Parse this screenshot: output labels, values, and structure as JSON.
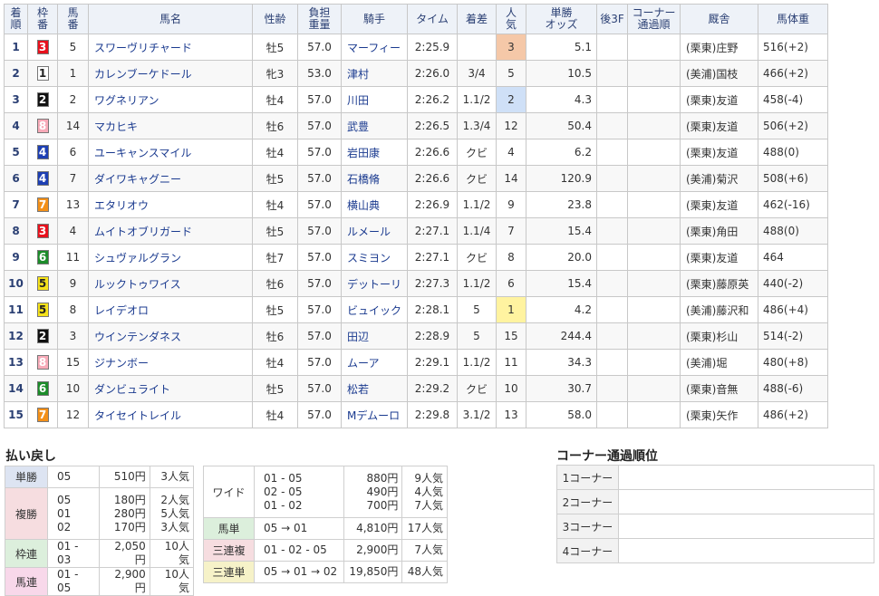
{
  "headers": {
    "chaku": [
      "着",
      "順"
    ],
    "waku": [
      "枠",
      "番"
    ],
    "uma": [
      "馬",
      "番"
    ],
    "name": "馬名",
    "sexage": "性齢",
    "futan": [
      "負担",
      "重量"
    ],
    "jockey": "騎手",
    "time": "タイム",
    "margin": "着差",
    "ninki": [
      "人",
      "気"
    ],
    "odds": [
      "単勝",
      "オッズ"
    ],
    "last3f": "後3F",
    "corner": [
      "コーナー",
      "通過順"
    ],
    "stable": "厩舎",
    "weight": "馬体重"
  },
  "waku_colors": {
    "1": "#ffffff",
    "2": "#111111",
    "3": "#e8111d",
    "4": "#1d3fb3",
    "5": "#f5e21a",
    "6": "#1c8c2a",
    "7": "#f39019",
    "8": "#f7aab8"
  },
  "rows": [
    {
      "chaku": "1",
      "waku": "3",
      "uma": "5",
      "name": "スワーヴリチャード",
      "sexage": "牡5",
      "futan": "57.0",
      "jockey": "マーフィー",
      "time": "2:25.9",
      "margin": "",
      "ninki": "3",
      "odds": "5.1",
      "last3f": "",
      "corner": "",
      "stable": "(栗東)庄野",
      "weight": "516(+2)"
    },
    {
      "chaku": "2",
      "waku": "1",
      "uma": "1",
      "name": "カレンブーケドール",
      "sexage": "牝3",
      "futan": "53.0",
      "jockey": "津村",
      "time": "2:26.0",
      "margin": "3/4",
      "ninki": "5",
      "odds": "10.5",
      "last3f": "",
      "corner": "",
      "stable": "(美浦)国枝",
      "weight": "466(+2)"
    },
    {
      "chaku": "3",
      "waku": "2",
      "uma": "2",
      "name": "ワグネリアン",
      "sexage": "牡4",
      "futan": "57.0",
      "jockey": "川田",
      "time": "2:26.2",
      "margin": "1.1/2",
      "ninki": "2",
      "odds": "4.3",
      "last3f": "",
      "corner": "",
      "stable": "(栗東)友道",
      "weight": "458(-4)"
    },
    {
      "chaku": "4",
      "waku": "8",
      "uma": "14",
      "name": "マカヒキ",
      "sexage": "牡6",
      "futan": "57.0",
      "jockey": "武豊",
      "time": "2:26.5",
      "margin": "1.3/4",
      "ninki": "12",
      "odds": "50.4",
      "last3f": "",
      "corner": "",
      "stable": "(栗東)友道",
      "weight": "506(+2)"
    },
    {
      "chaku": "5",
      "waku": "4",
      "uma": "6",
      "name": "ユーキャンスマイル",
      "sexage": "牡4",
      "futan": "57.0",
      "jockey": "岩田康",
      "time": "2:26.6",
      "margin": "クビ",
      "ninki": "4",
      "odds": "6.2",
      "last3f": "",
      "corner": "",
      "stable": "(栗東)友道",
      "weight": "488(0)"
    },
    {
      "chaku": "6",
      "waku": "4",
      "uma": "7",
      "name": "ダイワキャグニー",
      "sexage": "牡5",
      "futan": "57.0",
      "jockey": "石橋脩",
      "time": "2:26.6",
      "margin": "クビ",
      "ninki": "14",
      "odds": "120.9",
      "last3f": "",
      "corner": "",
      "stable": "(美浦)菊沢",
      "weight": "508(+6)"
    },
    {
      "chaku": "7",
      "waku": "7",
      "uma": "13",
      "name": "エタリオウ",
      "sexage": "牡4",
      "futan": "57.0",
      "jockey": "横山典",
      "time": "2:26.9",
      "margin": "1.1/2",
      "ninki": "9",
      "odds": "23.8",
      "last3f": "",
      "corner": "",
      "stable": "(栗東)友道",
      "weight": "462(-16)"
    },
    {
      "chaku": "8",
      "waku": "3",
      "uma": "4",
      "name": "ムイトオブリガード",
      "sexage": "牡5",
      "futan": "57.0",
      "jockey": "ルメール",
      "time": "2:27.1",
      "margin": "1.1/4",
      "ninki": "7",
      "odds": "15.4",
      "last3f": "",
      "corner": "",
      "stable": "(栗東)角田",
      "weight": "488(0)"
    },
    {
      "chaku": "9",
      "waku": "6",
      "uma": "11",
      "name": "シュヴァルグラン",
      "sexage": "牡7",
      "futan": "57.0",
      "jockey": "スミヨン",
      "time": "2:27.1",
      "margin": "クビ",
      "ninki": "8",
      "odds": "20.0",
      "last3f": "",
      "corner": "",
      "stable": "(栗東)友道",
      "weight": "464"
    },
    {
      "chaku": "10",
      "waku": "5",
      "uma": "9",
      "name": "ルックトゥワイス",
      "sexage": "牡6",
      "futan": "57.0",
      "jockey": "デットーリ",
      "time": "2:27.3",
      "margin": "1.1/2",
      "ninki": "6",
      "odds": "15.4",
      "last3f": "",
      "corner": "",
      "stable": "(栗東)藤原英",
      "weight": "440(-2)"
    },
    {
      "chaku": "11",
      "waku": "5",
      "uma": "8",
      "name": "レイデオロ",
      "sexage": "牡5",
      "futan": "57.0",
      "jockey": "ビュイック",
      "time": "2:28.1",
      "margin": "5",
      "ninki": "1",
      "odds": "4.2",
      "last3f": "",
      "corner": "",
      "stable": "(美浦)藤沢和",
      "weight": "486(+4)"
    },
    {
      "chaku": "12",
      "waku": "2",
      "uma": "3",
      "name": "ウインテンダネス",
      "sexage": "牡6",
      "futan": "57.0",
      "jockey": "田辺",
      "time": "2:28.9",
      "margin": "5",
      "ninki": "15",
      "odds": "244.4",
      "last3f": "",
      "corner": "",
      "stable": "(栗東)杉山",
      "weight": "514(-2)"
    },
    {
      "chaku": "13",
      "waku": "8",
      "uma": "15",
      "name": "ジナンボー",
      "sexage": "牡4",
      "futan": "57.0",
      "jockey": "ムーア",
      "time": "2:29.1",
      "margin": "1.1/2",
      "ninki": "11",
      "odds": "34.3",
      "last3f": "",
      "corner": "",
      "stable": "(美浦)堀",
      "weight": "480(+8)"
    },
    {
      "chaku": "14",
      "waku": "6",
      "uma": "10",
      "name": "ダンビュライト",
      "sexage": "牡5",
      "futan": "57.0",
      "jockey": "松若",
      "time": "2:29.2",
      "margin": "クビ",
      "ninki": "10",
      "odds": "30.7",
      "last3f": "",
      "corner": "",
      "stable": "(栗東)音無",
      "weight": "488(-6)"
    },
    {
      "chaku": "15",
      "waku": "7",
      "uma": "12",
      "name": "タイセイトレイル",
      "sexage": "牡4",
      "futan": "57.0",
      "jockey": "Mデムーロ",
      "time": "2:29.8",
      "margin": "3.1/2",
      "ninki": "13",
      "odds": "58.0",
      "last3f": "",
      "corner": "",
      "stable": "(栗東)矢作",
      "weight": "486(+2)"
    }
  ],
  "payout": {
    "title": "払い戻し",
    "tansho": {
      "label": "単勝",
      "combo": "05",
      "amount": "510円",
      "pop": "3人気"
    },
    "fukusho": {
      "label": "複勝",
      "lines": [
        {
          "combo": "05",
          "amount": "180円",
          "pop": "2人気"
        },
        {
          "combo": "01",
          "amount": "280円",
          "pop": "5人気"
        },
        {
          "combo": "02",
          "amount": "170円",
          "pop": "3人気"
        }
      ]
    },
    "wakuren": {
      "label": "枠連",
      "combo": "01 - 03",
      "amount": "2,050円",
      "pop": "10人気"
    },
    "umaren": {
      "label": "馬連",
      "combo": "01 - 05",
      "amount": "2,900円",
      "pop": "10人気"
    },
    "wide": {
      "label": "ワイド",
      "lines": [
        {
          "combo": "01 - 05",
          "amount": "880円",
          "pop": "9人気"
        },
        {
          "combo": "02 - 05",
          "amount": "490円",
          "pop": "4人気"
        },
        {
          "combo": "01 - 02",
          "amount": "700円",
          "pop": "7人気"
        }
      ]
    },
    "umatan": {
      "label": "馬単",
      "combo": "05 → 01",
      "amount": "4,810円",
      "pop": "17人気"
    },
    "sanrenpuku": {
      "label": "三連複",
      "combo": "01 - 02 - 05",
      "amount": "2,900円",
      "pop": "7人気"
    },
    "sanrentan": {
      "label": "三連単",
      "combo": "05 → 01 → 02",
      "amount": "19,850円",
      "pop": "48人気"
    }
  },
  "corner_order": {
    "title": "コーナー通過順位",
    "rows": [
      {
        "label": "1コーナー",
        "value": ""
      },
      {
        "label": "2コーナー",
        "value": ""
      },
      {
        "label": "3コーナー",
        "value": ""
      },
      {
        "label": "4コーナー",
        "value": ""
      }
    ]
  }
}
